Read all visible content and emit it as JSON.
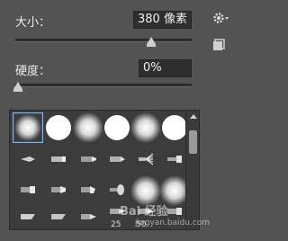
{
  "size": {
    "label": "大小：",
    "value": "380 像素",
    "slider_fraction": 0.77
  },
  "hardness": {
    "label": "硬度：",
    "value": "0%",
    "slider_fraction": 0.0
  },
  "icons": {
    "settings": "gear-icon",
    "new_preset": "new-preset-icon",
    "scroll_up": "scroll-up-icon"
  },
  "brush_grid": {
    "row1": [
      "soft-round",
      "hard-round",
      "soft-round",
      "hard-round",
      "soft-round",
      "hard-round"
    ],
    "tip_labels": [
      "25",
      "50"
    ]
  },
  "watermark": {
    "text": "Bai 经验",
    "sub": "jingyan.baidu.com"
  }
}
